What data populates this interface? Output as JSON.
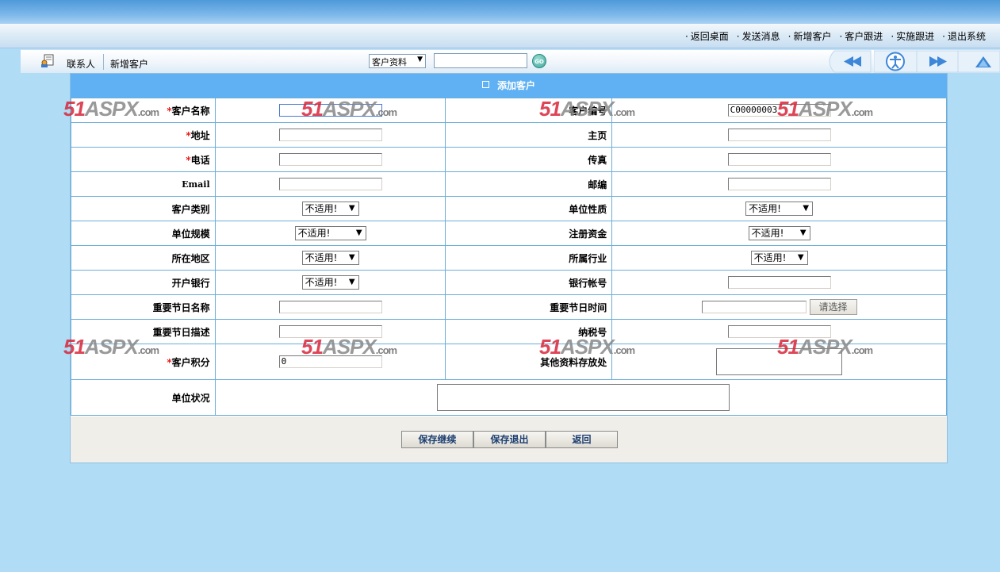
{
  "top_nav": {
    "links": [
      "返回桌面",
      "发送消息",
      "新增客户",
      "客户跟进",
      "实施跟进",
      "退出系统"
    ]
  },
  "toolbar": {
    "link_contacts": "联系人",
    "link_new_customer": "新增客户",
    "search_select_value": "客户资料",
    "search_value": "",
    "go_label": "GO"
  },
  "panel": {
    "title": "添加客户"
  },
  "form": {
    "customer_name_label": "客户名称",
    "customer_name_value": "",
    "customer_no_label": "客户编号",
    "customer_no_value": "C00000003",
    "address_label": "地址",
    "homepage_label": "主页",
    "phone_label": "电话",
    "fax_label": "传真",
    "email_label": "Email",
    "zip_label": "邮编",
    "category_label": "客户类别",
    "category_value": "不适用!",
    "nature_label": "单位性质",
    "nature_value": "不适用!",
    "scale_label": "单位规模",
    "scale_value": "不适用!",
    "capital_label": "注册资金",
    "capital_value": "不适用!",
    "region_label": "所在地区",
    "region_value": "不适用!",
    "industry_label": "所属行业",
    "industry_value": "不适用!",
    "bank_label": "开户银行",
    "bank_value": "不适用!",
    "account_label": "银行帐号",
    "holiday_name_label": "重要节日名称",
    "holiday_time_label": "重要节日时间",
    "pick_label": "请选择",
    "holiday_desc_label": "重要节日描述",
    "tax_label": "纳税号",
    "points_label": "客户积分",
    "points_value": "0",
    "other_label": "其他资料存放处",
    "status_label": "单位状况"
  },
  "actions": {
    "save_continue": "保存继续",
    "save_exit": "保存退出",
    "back": "返回"
  },
  "watermark": {
    "num": "51",
    "brand": "ASPX",
    "suffix": ".com"
  }
}
